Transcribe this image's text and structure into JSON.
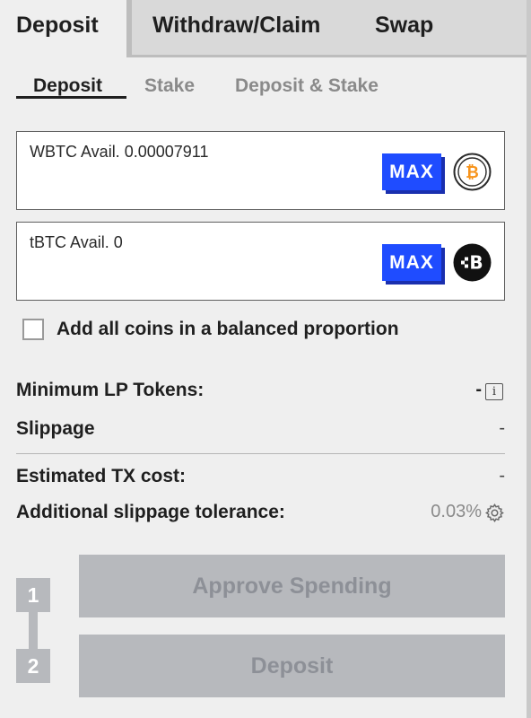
{
  "tabs": [
    {
      "label": "Deposit",
      "active": true
    },
    {
      "label": "Withdraw/Claim",
      "active": false
    },
    {
      "label": "Swap",
      "active": false
    }
  ],
  "subtabs": [
    {
      "label": "Deposit",
      "active": true
    },
    {
      "label": "Stake",
      "active": false
    },
    {
      "label": "Deposit & Stake",
      "active": false
    }
  ],
  "coins": [
    {
      "label": "WBTC Avail. 0.00007911",
      "max_label": "MAX",
      "icon": "bitcoin-icon",
      "icon_glyph": "₿"
    },
    {
      "label": "tBTC Avail. 0",
      "max_label": "MAX",
      "icon": "tbtc-icon",
      "icon_glyph": "B"
    }
  ],
  "checkbox": {
    "label": "Add all coins in a balanced proportion",
    "checked": false
  },
  "info": {
    "min_lp_label": "Minimum LP Tokens:",
    "min_lp_value": "-",
    "slippage_label": "Slippage",
    "slippage_value": "-",
    "tx_cost_label": "Estimated TX cost:",
    "tx_cost_value": "-",
    "tolerance_label": "Additional slippage tolerance:",
    "tolerance_value": "0.03%",
    "info_glyph": "i"
  },
  "steps": [
    {
      "number": "1",
      "label": "Approve Spending",
      "enabled": false
    },
    {
      "number": "2",
      "label": "Deposit",
      "enabled": false
    }
  ],
  "colors": {
    "accent": "#1f4cff",
    "disabled": "#b7b9bd",
    "bitcoin": "#f7931a"
  }
}
